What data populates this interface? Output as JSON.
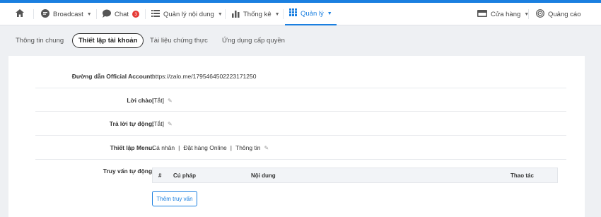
{
  "nav": {
    "broadcast": "Broadcast",
    "chat": "Chat",
    "chat_badge": "3",
    "content": "Quản lý nội dung",
    "stats": "Thống kê",
    "manage": "Quản lý",
    "store": "Cửa hàng",
    "ads": "Quảng cáo",
    "accent_color": "#1a7fe0"
  },
  "tabs": [
    "Thông tin chung",
    "Thiết lập tài khoản",
    "Tài liệu chứng thực",
    "Ứng dụng cấp quyền"
  ],
  "settings": {
    "oa_link": {
      "label": "Đường dẫn Official Account:",
      "value": "https://zalo.me/1795464502223171250"
    },
    "greeting": {
      "label": "Lời chào:",
      "value": "[Tắt]"
    },
    "auto_reply": {
      "label": "Trả lời tự động:",
      "value": "[Tắt]"
    },
    "menu": {
      "label": "Thiết lập Menu:",
      "items": [
        "Cá nhân",
        "Đặt hàng Online",
        "Thông tin"
      ],
      "divider": "|"
    },
    "auto_query": {
      "label": "Truy vấn tự động:"
    }
  },
  "query_table": {
    "columns": [
      "#",
      "Cú pháp",
      "Nội dung",
      "Thao tác"
    ],
    "add_button": "Thêm truy vấn"
  },
  "icons": {
    "home": "home-icon",
    "broadcast": "broadcast-icon",
    "chat": "chat-icon",
    "content": "list-icon",
    "stats": "bar-chart-icon",
    "manage": "grid-icon",
    "store": "store-icon",
    "ads": "target-icon",
    "edit": "pencil-icon"
  }
}
